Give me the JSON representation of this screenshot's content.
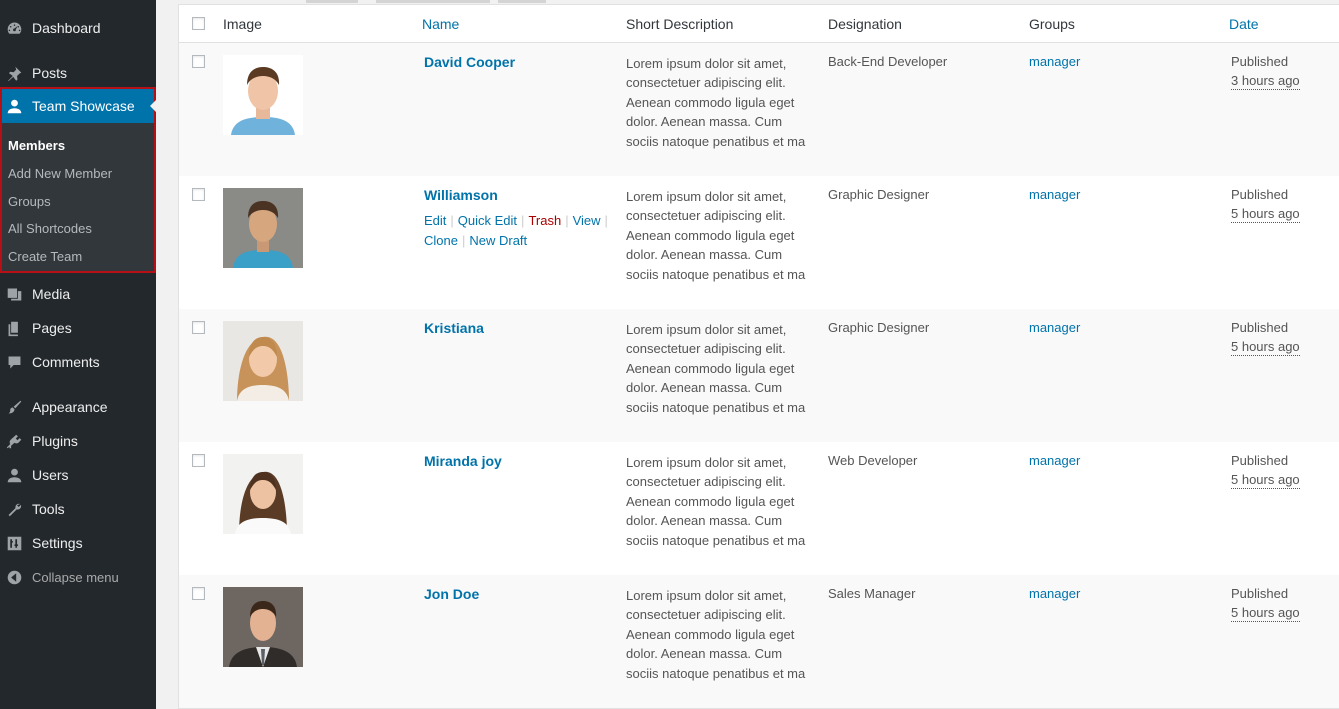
{
  "sidebar": {
    "dashboard": {
      "label": "Dashboard",
      "icon": "dashboard-icon"
    },
    "posts": {
      "label": "Posts",
      "icon": "pin-icon"
    },
    "team_showcase": {
      "label": "Team Showcase",
      "icon": "user-icon"
    },
    "submenu": [
      {
        "label": "Members",
        "current": true
      },
      {
        "label": "Add New Member"
      },
      {
        "label": "Groups"
      },
      {
        "label": "All Shortcodes"
      },
      {
        "label": "Create Team"
      }
    ],
    "media": {
      "label": "Media",
      "icon": "media-icon"
    },
    "pages": {
      "label": "Pages",
      "icon": "pages-icon"
    },
    "comments": {
      "label": "Comments",
      "icon": "comment-icon"
    },
    "appearance": {
      "label": "Appearance",
      "icon": "paintbrush-icon"
    },
    "plugins": {
      "label": "Plugins",
      "icon": "plugin-icon"
    },
    "users": {
      "label": "Users",
      "icon": "users-icon"
    },
    "tools": {
      "label": "Tools",
      "icon": "wrench-icon"
    },
    "settings": {
      "label": "Settings",
      "icon": "settings-icon"
    },
    "collapse": {
      "label": "Collapse menu",
      "icon": "collapse-icon"
    }
  },
  "table": {
    "headers": {
      "image": "Image",
      "name": "Name",
      "short_description": "Short Description",
      "designation": "Designation",
      "groups": "Groups",
      "date": "Date"
    },
    "rows": [
      {
        "name": "David Cooper",
        "description": "Lorem ipsum dolor sit amet, consectetuer adipiscing elit. Aenean commodo ligula eget dolor. Aenean massa. Cum sociis natoque penatibus et ma",
        "designation": "Back-End Developer",
        "group": "manager",
        "status": "Published",
        "ago": "3 hours ago"
      },
      {
        "name": "Williamson",
        "description": "Lorem ipsum dolor sit amet, consectetuer adipiscing elit. Aenean commodo ligula eget dolor. Aenean massa. Cum sociis natoque penatibus et ma",
        "designation": "Graphic Designer",
        "group": "manager",
        "status": "Published",
        "ago": "5 hours ago",
        "actions": {
          "edit": "Edit",
          "quick_edit": "Quick Edit",
          "trash": "Trash",
          "view": "View",
          "clone": "Clone",
          "new_draft": "New Draft"
        }
      },
      {
        "name": "Kristiana",
        "description": "Lorem ipsum dolor sit amet, consectetuer adipiscing elit. Aenean commodo ligula eget dolor. Aenean massa. Cum sociis natoque penatibus et ma",
        "designation": "Graphic Designer",
        "group": "manager",
        "status": "Published",
        "ago": "5 hours ago"
      },
      {
        "name": "Miranda joy",
        "description": "Lorem ipsum dolor sit amet, consectetuer adipiscing elit. Aenean commodo ligula eget dolor. Aenean massa. Cum sociis natoque penatibus et ma",
        "designation": "Web Developer",
        "group": "manager",
        "status": "Published",
        "ago": "5 hours ago"
      },
      {
        "name": "Jon Doe",
        "description": "Lorem ipsum dolor sit amet, consectetuer adipiscing elit. Aenean commodo ligula eget dolor. Aenean massa. Cum sociis natoque penatibus et ma",
        "designation": "Sales Manager",
        "group": "manager",
        "status": "Published",
        "ago": "5 hours ago"
      }
    ]
  },
  "colors": {
    "sidebar_bg": "#23282d",
    "submenu_bg": "#32373c",
    "accent": "#0073aa",
    "highlight_border": "#b61016",
    "trash": "#aa0000"
  }
}
